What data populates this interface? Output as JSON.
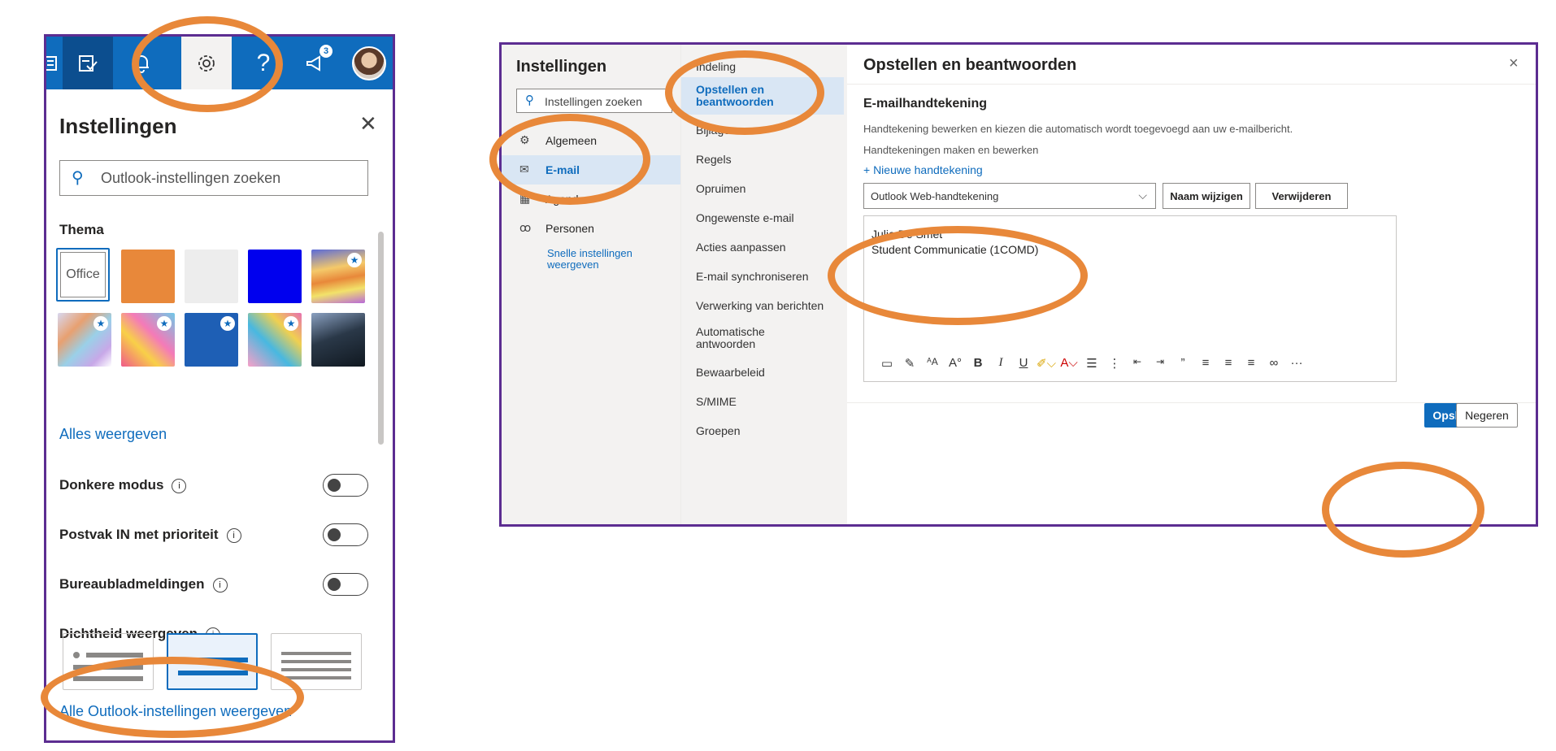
{
  "accent_color": "#0f6cbd",
  "highlight_color": "#e8883a",
  "frame_color": "#5c2d91",
  "quick_panel": {
    "topbar": {
      "icons": [
        "word-icon",
        "todo-icon",
        "bell-icon",
        "gear-icon",
        "help-icon",
        "megaphone-icon"
      ],
      "help_glyph": "?",
      "notification_count": "3"
    },
    "title": "Instellingen",
    "search_placeholder": "Outlook-instellingen zoeken",
    "theme": {
      "label": "Thema",
      "office_label": "Office",
      "show_all": "Alles weergeven"
    },
    "toggles": [
      {
        "label": "Donkere modus",
        "on": false
      },
      {
        "label": "Postvak IN met prioriteit",
        "on": false
      },
      {
        "label": "Bureaubladmeldingen",
        "on": false
      }
    ],
    "density_label": "Dichtheid weergeven",
    "all_settings_link": "Alle Outlook-instellingen weergeven"
  },
  "settings_window": {
    "title": "Instellingen",
    "search_placeholder": "Instellingen zoeken",
    "nav": [
      {
        "label": "Algemeen",
        "icon": "gear-icon"
      },
      {
        "label": "E-mail",
        "icon": "mail-icon",
        "selected": true
      },
      {
        "label": "Agenda",
        "icon": "calendar-icon"
      },
      {
        "label": "Personen",
        "icon": "people-icon"
      }
    ],
    "quick_settings": "Snelle instellingen weergeven",
    "subnav": [
      "Indeling",
      "Opstellen en beantwoorden",
      "Bijlagen",
      "Regels",
      "Opruimen",
      "Ongewenste e-mail",
      "Acties aanpassen",
      "E-mail synchroniseren",
      "Verwerking van berichten",
      "Automatische antwoorden",
      "Bewaarbeleid",
      "S/MIME",
      "Groepen"
    ],
    "content": {
      "title": "Opstellen en beantwoorden",
      "close_glyph": "×",
      "signature_heading": "E-mailhandtekening",
      "signature_description": "Handtekening bewerken en kiezen die automatisch wordt toegevoegd aan uw e-mailbericht.",
      "signature_create": "Handtekeningen maken en bewerken",
      "new_signature": "+ Nieuwe handtekening",
      "selected_signature": "Outlook Web-handtekening",
      "rename_button": "Naam wijzigen",
      "delete_button": "Verwijderen",
      "signature_lines": [
        "Julie De Smet",
        "Student Communicatie (1COMD)"
      ],
      "save_button": "Opslaan",
      "discard_button": "Negeren"
    }
  }
}
